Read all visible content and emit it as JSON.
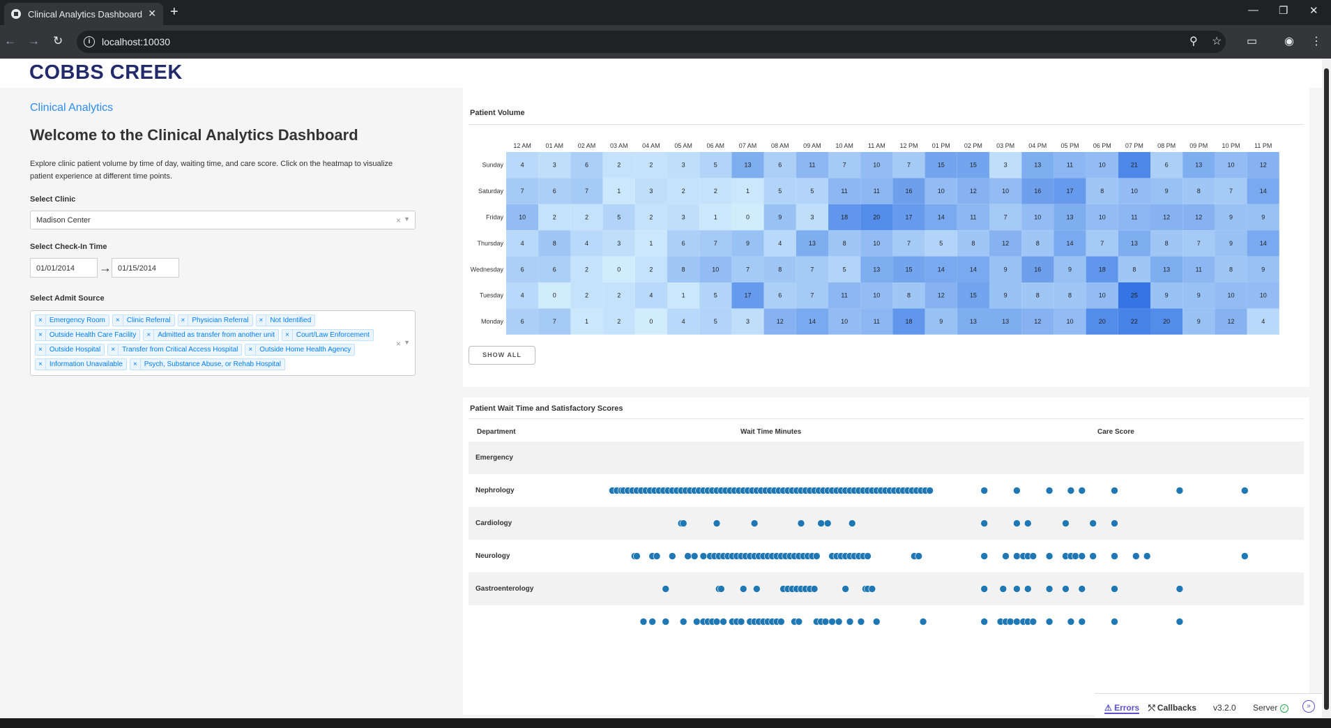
{
  "browser": {
    "tab_title": "Clinical Analytics Dashboard",
    "url": "localhost:10030"
  },
  "header": {
    "logo": "COBBS CREEK"
  },
  "sidebar": {
    "subtitle": "Clinical Analytics",
    "welcome": "Welcome to the Clinical Analytics Dashboard",
    "intro": "Explore clinic patient volume by time of day, waiting time, and care score. Click on the heatmap to visualize patient experience at different time points.",
    "clinic_label": "Select Clinic",
    "clinic_value": "Madison Center",
    "checkin_label": "Select Check-In Time",
    "date_start": "01/01/2014",
    "date_end": "01/15/2014",
    "admit_label": "Select Admit Source",
    "admit_sources": [
      "Emergency Room",
      "Clinic Referral",
      "Physician Referral",
      "Not Identified",
      "Outside Health Care Facility",
      "Admitted as transfer from another unit",
      "Court/Law Enforcement",
      "Outside Hospital",
      "Transfer from Critical Access Hospital",
      "Outside Home Health Agency",
      "Information Unavailable",
      "Psych, Substance Abuse, or Rehab Hospital"
    ]
  },
  "volume_card": {
    "title": "Patient Volume",
    "show_all": "SHOW ALL"
  },
  "wait_card": {
    "title": "Patient Wait Time and Satisfactory Scores",
    "col_department": "Department",
    "col_wait": "Wait Time Minutes",
    "col_care": "Care Score",
    "departments": [
      "Emergency",
      "Nephrology",
      "Cardiology",
      "Neurology",
      "Gastroenterology",
      ""
    ]
  },
  "chart_data": [
    {
      "type": "heatmap",
      "title": "Patient Volume",
      "x": [
        "12 AM",
        "01 AM",
        "02 AM",
        "03 AM",
        "04 AM",
        "05 AM",
        "06 AM",
        "07 AM",
        "08 AM",
        "09 AM",
        "10 AM",
        "11 AM",
        "12 PM",
        "01 PM",
        "02 PM",
        "03 PM",
        "04 PM",
        "05 PM",
        "06 PM",
        "07 PM",
        "08 PM",
        "09 PM",
        "10 PM",
        "11 PM"
      ],
      "y": [
        "Sunday",
        "Saturday",
        "Friday",
        "Thursday",
        "Wednesday",
        "Tuesday",
        "Monday"
      ],
      "z": [
        [
          4,
          3,
          6,
          2,
          2,
          3,
          5,
          13,
          6,
          11,
          7,
          10,
          7,
          15,
          15,
          3,
          13,
          11,
          10,
          21,
          6,
          13,
          10,
          12
        ],
        [
          7,
          6,
          7,
          1,
          3,
          2,
          2,
          1,
          5,
          5,
          11,
          11,
          16,
          10,
          12,
          10,
          16,
          17,
          8,
          10,
          9,
          8,
          7,
          14
        ],
        [
          10,
          2,
          2,
          5,
          2,
          3,
          1,
          0,
          9,
          3,
          18,
          20,
          17,
          14,
          11,
          7,
          10,
          13,
          10,
          11,
          12,
          12,
          9,
          9
        ],
        [
          4,
          8,
          4,
          3,
          1,
          6,
          7,
          9,
          4,
          13,
          8,
          10,
          7,
          5,
          8,
          12,
          8,
          14,
          7,
          13,
          8,
          7,
          9,
          14
        ],
        [
          6,
          6,
          2,
          0,
          2,
          8,
          10,
          7,
          8,
          7,
          5,
          13,
          15,
          14,
          14,
          9,
          16,
          9,
          18,
          8,
          13,
          11,
          8,
          9
        ],
        [
          4,
          0,
          2,
          2,
          4,
          1,
          5,
          17,
          6,
          7,
          11,
          10,
          8,
          12,
          15,
          9,
          8,
          8,
          10,
          25,
          9,
          9,
          10,
          10
        ],
        [
          6,
          7,
          1,
          2,
          0,
          4,
          5,
          3,
          12,
          14,
          10,
          11,
          18,
          9,
          13,
          13,
          12,
          10,
          20,
          22,
          20,
          9,
          12,
          4
        ]
      ],
      "colors": [
        "#d1ecfd",
        "#5a91ea"
      ]
    },
    {
      "type": "scatter",
      "title": "Wait Time Minutes",
      "xticks": [
        0,
        20,
        40,
        60,
        80,
        100,
        120,
        140
      ],
      "xlim": [
        0,
        147
      ],
      "series": [
        {
          "values": []
        },
        {
          "values": [
            2,
            4,
            6,
            7,
            9,
            11,
            13,
            15,
            17,
            19,
            21,
            23,
            25,
            27,
            29,
            31,
            33,
            35,
            37,
            39,
            41,
            43,
            45,
            47,
            49,
            51,
            53,
            55,
            57,
            59,
            61,
            63,
            65,
            67,
            69,
            71,
            73,
            75,
            77,
            79,
            81,
            83,
            85,
            87,
            89,
            91,
            93,
            95,
            97,
            99,
            101,
            103,
            105,
            107,
            109,
            111,
            113,
            115,
            117,
            119,
            121,
            123,
            125,
            127,
            129,
            131,
            133,
            135,
            137,
            139,
            141,
            143,
            145
          ]
        },
        {
          "values": [
            33,
            34,
            49,
            66,
            87,
            96,
            99,
            110
          ]
        },
        {
          "values": [
            12,
            13,
            20,
            22,
            29,
            36,
            39,
            43,
            46,
            48,
            50,
            52,
            54,
            56,
            58,
            60,
            62,
            64,
            66,
            68,
            70,
            72,
            74,
            76,
            78,
            80,
            82,
            84,
            86,
            88,
            90,
            92,
            94,
            101,
            103,
            105,
            107,
            109,
            111,
            113,
            115,
            117,
            138,
            140
          ]
        },
        {
          "values": [
            26,
            50,
            51,
            61,
            67,
            79,
            81,
            83,
            85,
            87,
            89,
            91,
            93,
            107,
            116,
            117,
            119
          ]
        },
        {
          "values": [
            16,
            20,
            26,
            34,
            40,
            43,
            45,
            47,
            49,
            52,
            56,
            58,
            60,
            64,
            66,
            68,
            70,
            72,
            74,
            76,
            78,
            84,
            86,
            94,
            96,
            98,
            101,
            104,
            109,
            114,
            121,
            142
          ]
        }
      ]
    },
    {
      "type": "scatter",
      "title": "Care Score",
      "xticks": [
        2,
        2.5,
        3,
        3.5,
        4,
        4.5,
        5,
        5.5,
        6
      ],
      "xlim": [
        1.5,
        6.5
      ],
      "series": [
        {
          "values": []
        },
        {
          "values": [
            2,
            2.5,
            3,
            3.33,
            3.5,
            4,
            5,
            6
          ]
        },
        {
          "values": [
            2,
            2.5,
            2.67,
            3.25,
            3.67,
            4
          ]
        },
        {
          "values": [
            2,
            2.33,
            2.5,
            2.6,
            2.67,
            2.75,
            3,
            3.25,
            3.33,
            3.4,
            3.5,
            3.67,
            4,
            4.33,
            4.5,
            6
          ]
        },
        {
          "values": [
            2,
            2.29,
            2.5,
            2.67,
            3,
            3.25,
            3.5,
            4,
            5
          ]
        },
        {
          "values": [
            2,
            2.25,
            2.33,
            2.4,
            2.5,
            2.6,
            2.67,
            2.75,
            3,
            3.33,
            3.5,
            4,
            5
          ]
        }
      ]
    }
  ]
}
